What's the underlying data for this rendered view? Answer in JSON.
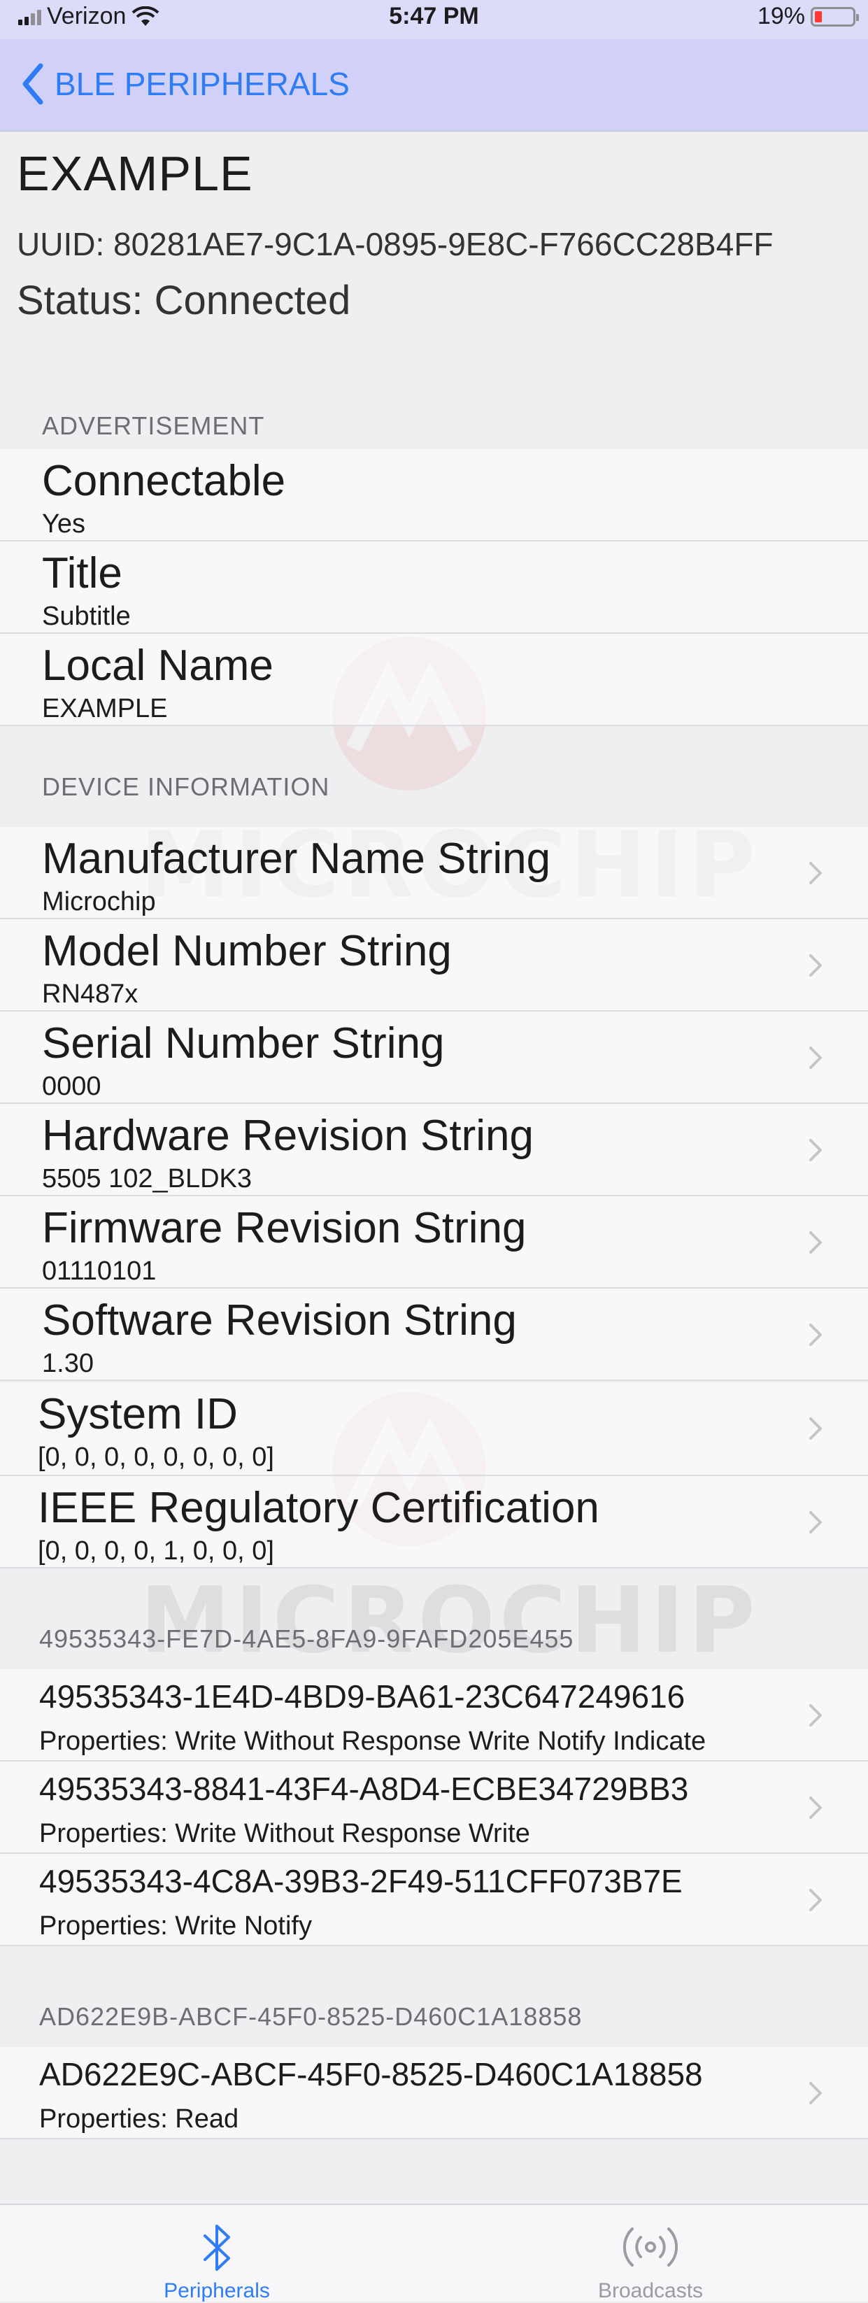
{
  "status_bar": {
    "carrier": "Verizon",
    "time": "5:47 PM",
    "battery": "19%",
    "battery_color": "#ff3b30"
  },
  "nav": {
    "back_label": "BLE PERIPHERALS",
    "accent": "#2e7cf6"
  },
  "device": {
    "name": "EXAMPLE",
    "uuid": "UUID: 80281AE7-9C1A-0895-9E8C-F766CC28B4FF",
    "status": "Status: Connected"
  },
  "watermark": {
    "text": "MICROCHIP",
    "icon": "microchip-logo"
  },
  "advertisement": {
    "header": "ADVERTISEMENT",
    "rows": [
      {
        "title": "Connectable",
        "subtitle": "Yes"
      },
      {
        "title": "Title",
        "subtitle": "Subtitle"
      },
      {
        "title": "Local Name",
        "subtitle": "EXAMPLE"
      }
    ]
  },
  "device_information": {
    "header": "DEVICE INFORMATION",
    "rows": [
      {
        "title": "Manufacturer Name String",
        "subtitle": "Microchip"
      },
      {
        "title": "Model Number String",
        "subtitle": "RN487x"
      },
      {
        "title": "Serial Number String",
        "subtitle": "0000"
      },
      {
        "title": "Hardware Revision String",
        "subtitle": "5505 102_BLDK3"
      },
      {
        "title": "Firmware Revision String",
        "subtitle": "01110101"
      },
      {
        "title": "Software Revision String",
        "subtitle": "1.30"
      },
      {
        "title": "System ID",
        "subtitle": "[0, 0, 0, 0, 0, 0, 0, 0]"
      },
      {
        "title": "IEEE Regulatory Certification",
        "subtitle": "[0, 0, 0, 0, 1, 0, 0, 0]"
      }
    ]
  },
  "service_1": {
    "header": "49535343-FE7D-4AE5-8FA9-9FAFD205E455",
    "rows": [
      {
        "title": "49535343-1E4D-4BD9-BA61-23C647249616",
        "subtitle": "Properties: Write Without Response Write Notify Indicate"
      },
      {
        "title": "49535343-8841-43F4-A8D4-ECBE34729BB3",
        "subtitle": "Properties: Write Without Response Write"
      },
      {
        "title": "49535343-4C8A-39B3-2F49-511CFF073B7E",
        "subtitle": "Properties: Write Notify"
      }
    ]
  },
  "service_2": {
    "header": "AD622E9B-ABCF-45F0-8525-D460C1A18858",
    "rows": [
      {
        "title": "AD622E9C-ABCF-45F0-8525-D460C1A18858",
        "subtitle": "Properties: Read"
      }
    ]
  },
  "tabs": [
    {
      "label": "Peripherals",
      "icon": "bluetooth-icon",
      "active": true
    },
    {
      "label": "Broadcasts",
      "icon": "broadcast-icon",
      "active": false
    }
  ]
}
